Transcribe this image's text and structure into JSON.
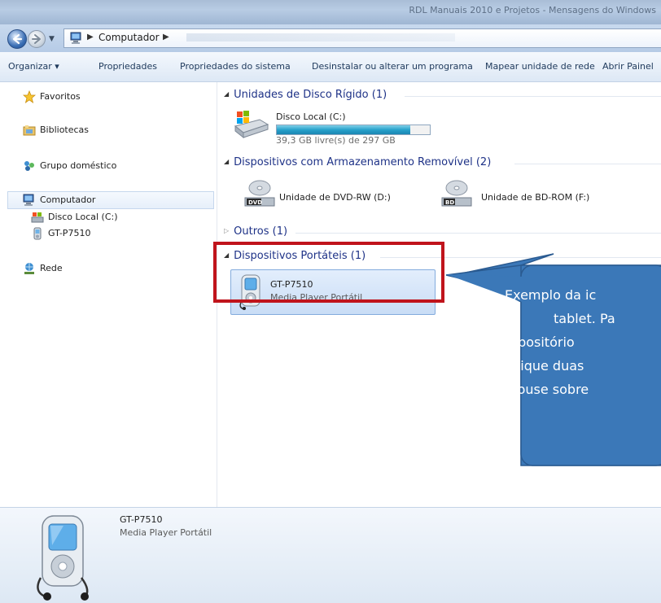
{
  "window": {
    "title": "RDL Manuais 2010 e Projetos - Mensagens do Windows"
  },
  "address": {
    "location": "Computador"
  },
  "toolbar": {
    "organize": "Organizar ▾",
    "properties": "Propriedades",
    "system_properties": "Propriedades do sistema",
    "uninstall": "Desinstalar ou alterar um programa",
    "map_drive": "Mapear unidade de rede",
    "control_panel": "Abrir Painel"
  },
  "sidebar": {
    "favorites": "Favoritos",
    "libraries": "Bibliotecas",
    "homegroup": "Grupo doméstico",
    "computer": "Computador",
    "local_disk": "Disco Local (C:)",
    "device": "GT-P7510",
    "network": "Rede"
  },
  "groups": {
    "hdd": "Unidades de Disco Rígido (1)",
    "removable": "Dispositivos com Armazenamento Removível (2)",
    "others": "Outros (1)",
    "portable": "Dispositivos Portáteis (1)"
  },
  "drives": {
    "local": {
      "name": "Disco Local (C:)",
      "free": "39,3 GB livre(s) de 297 GB",
      "used_fraction": 0.87
    },
    "dvd": {
      "name": "Unidade de DVD-RW (D:)"
    },
    "bd": {
      "name": "Unidade de BD-ROM (F:)"
    }
  },
  "portable_device": {
    "name": "GT-P7510",
    "type": "Media Player Portátil"
  },
  "callout": {
    "lines": [
      "Exemplo da ic",
      "tablet. Pa",
      "repositório",
      "clique duas",
      "mouse sobre"
    ]
  },
  "details": {
    "name": "GT-P7510",
    "type": "Media Player Portátil"
  },
  "colors": {
    "callout_fill": "#3b78b8",
    "highlight_border": "#c0141c",
    "group_header_text": "#1e3287"
  }
}
